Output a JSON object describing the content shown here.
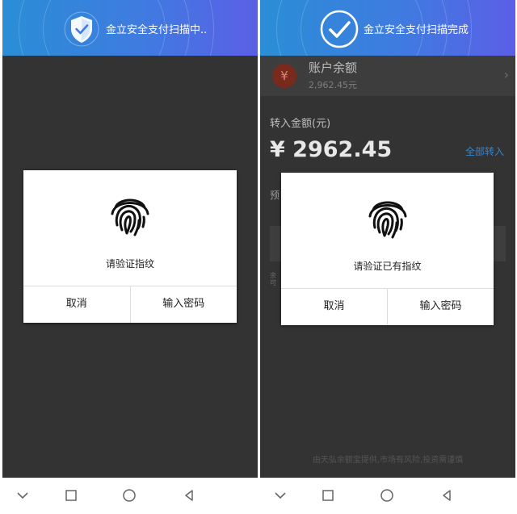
{
  "left_screen": {
    "banner_text": "金立安全支付扫描中..",
    "dialog": {
      "prompt": "请验证指纹",
      "cancel_label": "取消",
      "password_label": "输入密码"
    }
  },
  "right_screen": {
    "banner_text": "金立安全支付扫描完成",
    "account": {
      "icon_symbol": "¥",
      "title": "账户余额",
      "balance": "2,962.45元"
    },
    "transfer_label": "转入金额(元)",
    "amount": "¥ 2962.45",
    "all_transfer_label": "全部转入",
    "fragment_1": "预",
    "fragment_2": "余\n可",
    "dialog": {
      "prompt": "请验证已有指纹",
      "cancel_label": "取消",
      "password_label": "输入密码"
    },
    "footer_note": "由天弘余额宝提供,市场有风险,投资需谨慎"
  },
  "navbar": {
    "icons": [
      "back-chevron-icon",
      "recents-square-icon",
      "home-circle-icon",
      "back-triangle-icon",
      "back-chevron-icon",
      "recents-square-icon",
      "home-circle-icon",
      "back-triangle-icon"
    ]
  },
  "colors": {
    "banner_start": "#2a8ed6",
    "banner_end": "#5b5fe6",
    "dim_background": "#333333",
    "accent_link": "#2f87d6"
  }
}
